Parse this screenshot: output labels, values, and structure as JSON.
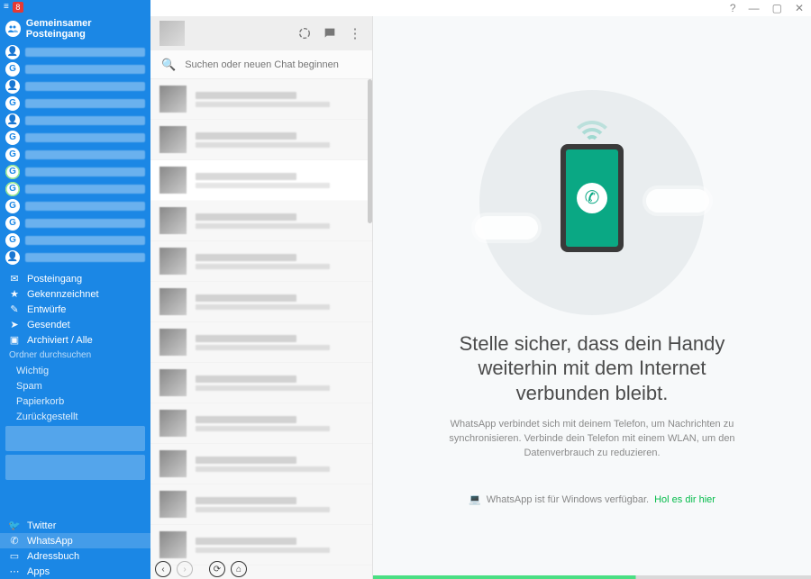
{
  "window": {
    "help": "?",
    "min": "—",
    "max": "▢",
    "close": "✕"
  },
  "badge": "8",
  "sidebar": {
    "title": "Gemeinsamer Posteingang",
    "folders": {
      "inbox": "Posteingang",
      "starred": "Gekennzeichnet",
      "drafts": "Entwürfe",
      "sent": "Gesendet",
      "archive": "Archiviert / Alle",
      "search": "Ordner durchsuchen",
      "important": "Wichtig",
      "spam": "Spam",
      "trash": "Papierkorb",
      "snoozed": "Zurückgestellt"
    },
    "bottom": {
      "twitter": "Twitter",
      "whatsapp": "WhatsApp",
      "contacts": "Adressbuch",
      "apps": "Apps"
    }
  },
  "whatsapp": {
    "search_placeholder": "Suchen oder neuen Chat beginnen",
    "headline": "Stelle sicher, dass dein Handy weiterhin mit dem Internet verbunden bleibt.",
    "subtext": "WhatsApp verbindet sich mit deinem Telefon, um Nachrichten zu synchronisieren. Verbinde dein Telefon mit einem WLAN, um den Datenverbrauch zu reduzieren.",
    "dl_text": "WhatsApp ist für Windows verfügbar.",
    "dl_link": "Hol es dir hier"
  }
}
